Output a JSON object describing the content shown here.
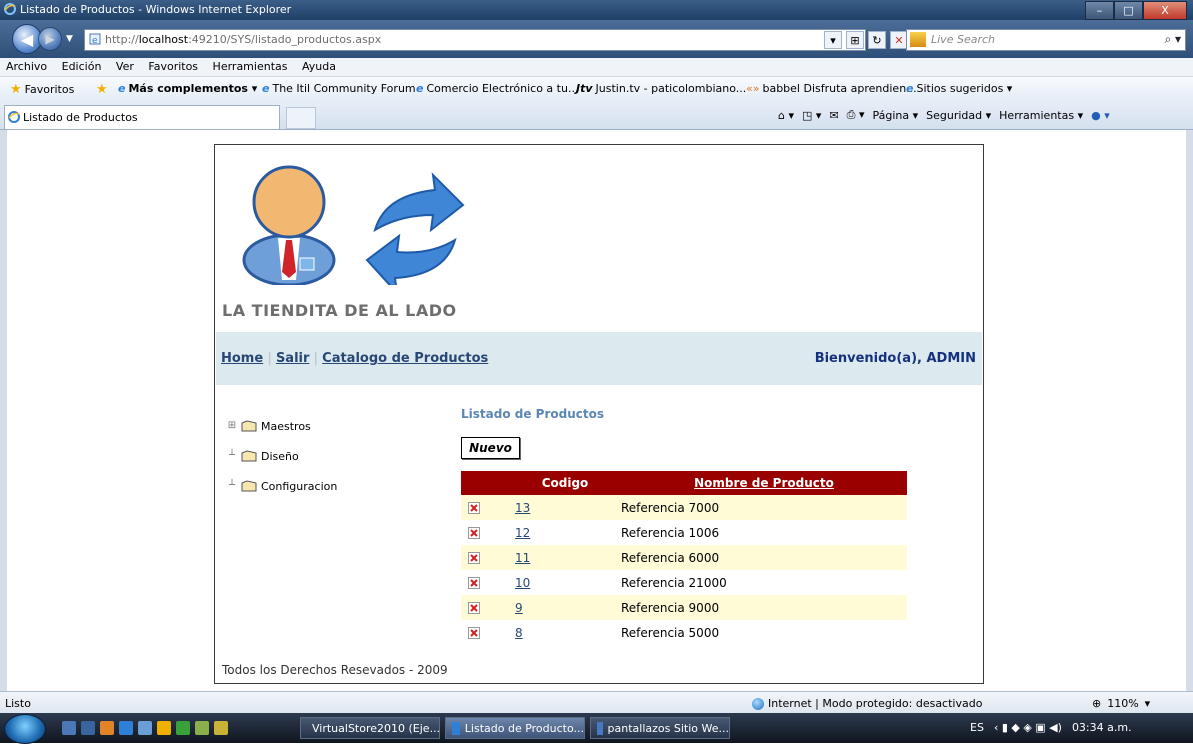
{
  "window": {
    "title": "Listado de Productos - Windows Internet Explorer",
    "min": "–",
    "max": "□",
    "close": "X"
  },
  "addressbar": {
    "url_prefix": "http://",
    "url_host": "localhost",
    "url_rest": ":49210/SYS/listado_productos.aspx",
    "search_placeholder": "Live Search"
  },
  "menu": [
    "Archivo",
    "Edición",
    "Ver",
    "Favoritos",
    "Herramientas",
    "Ayuda"
  ],
  "favorites": {
    "label": "Favoritos",
    "more": "Más complementos ▾",
    "links": [
      "The Itil Community Forum",
      "Comercio Electrónico a tu...",
      "Justin.tv - paticolombiano...",
      "babbel Disfruta aprendien...",
      "Sitios sugeridos ▾"
    ]
  },
  "tab": {
    "label": "Listado de Productos"
  },
  "commands": {
    "pagina": "Página ▾",
    "seguridad": "Seguridad ▾",
    "herramientas": "Herramientas ▾"
  },
  "site": {
    "name": "LA TIENDITA DE AL LADO",
    "nav": {
      "home": "Home",
      "salir": "Salir",
      "catalogo": "Catalogo de Productos"
    },
    "welcome": "Bienvenido(a), ADMIN",
    "tree": [
      "Maestros",
      "Diseño",
      "Configuracion"
    ],
    "list_title": "Listado de Productos",
    "new_button": "Nuevo",
    "grid": {
      "headers": [
        "Codigo",
        "Nombre de Producto"
      ],
      "rows": [
        {
          "code": "13",
          "name": "Referencia 7000"
        },
        {
          "code": "12",
          "name": "Referencia 1006"
        },
        {
          "code": "11",
          "name": "Referencia 6000"
        },
        {
          "code": "10",
          "name": "Referencia 21000"
        },
        {
          "code": "9",
          "name": "Referencia 9000"
        },
        {
          "code": "8",
          "name": "Referencia 5000"
        }
      ]
    },
    "footer": "Todos los Derechos Resevados - 2009"
  },
  "status": {
    "left": "Listo",
    "zone": "Internet | Modo protegido: desactivado",
    "zoom": "110%"
  },
  "taskbar": {
    "tasks": [
      "VirtualStore2010 (Eje...",
      "Listado de Producto...",
      "pantallazos Sitio We..."
    ],
    "lang": "ES",
    "clock": "03:34 a.m."
  }
}
